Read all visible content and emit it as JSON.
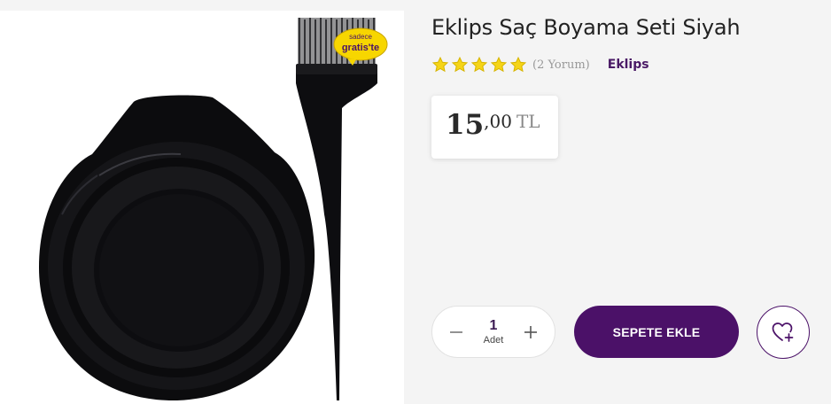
{
  "product": {
    "title": "Eklips Saç Boyama Seti Siyah",
    "review_count_text": "(2 Yorum)",
    "brand": "Eklips",
    "rating": 5,
    "rating_max": 5,
    "image_badge_line1": "sadece",
    "image_badge_line2": "gratis'te"
  },
  "price": {
    "integer": "15",
    "decimal": ",00",
    "currency": "TL"
  },
  "quantity": {
    "value": "1",
    "unit": "Adet",
    "decrease_icon": "minus-icon",
    "increase_icon": "plus-icon"
  },
  "actions": {
    "add_to_cart_label": "SEPETE EKLE",
    "favorite_icon": "heart-plus-icon"
  },
  "colors": {
    "primary": "#4b1168",
    "brand_text": "#4a1a66",
    "star": "#f5d417",
    "page_bg": "#f4f4f4",
    "badge": "#f7d600"
  }
}
